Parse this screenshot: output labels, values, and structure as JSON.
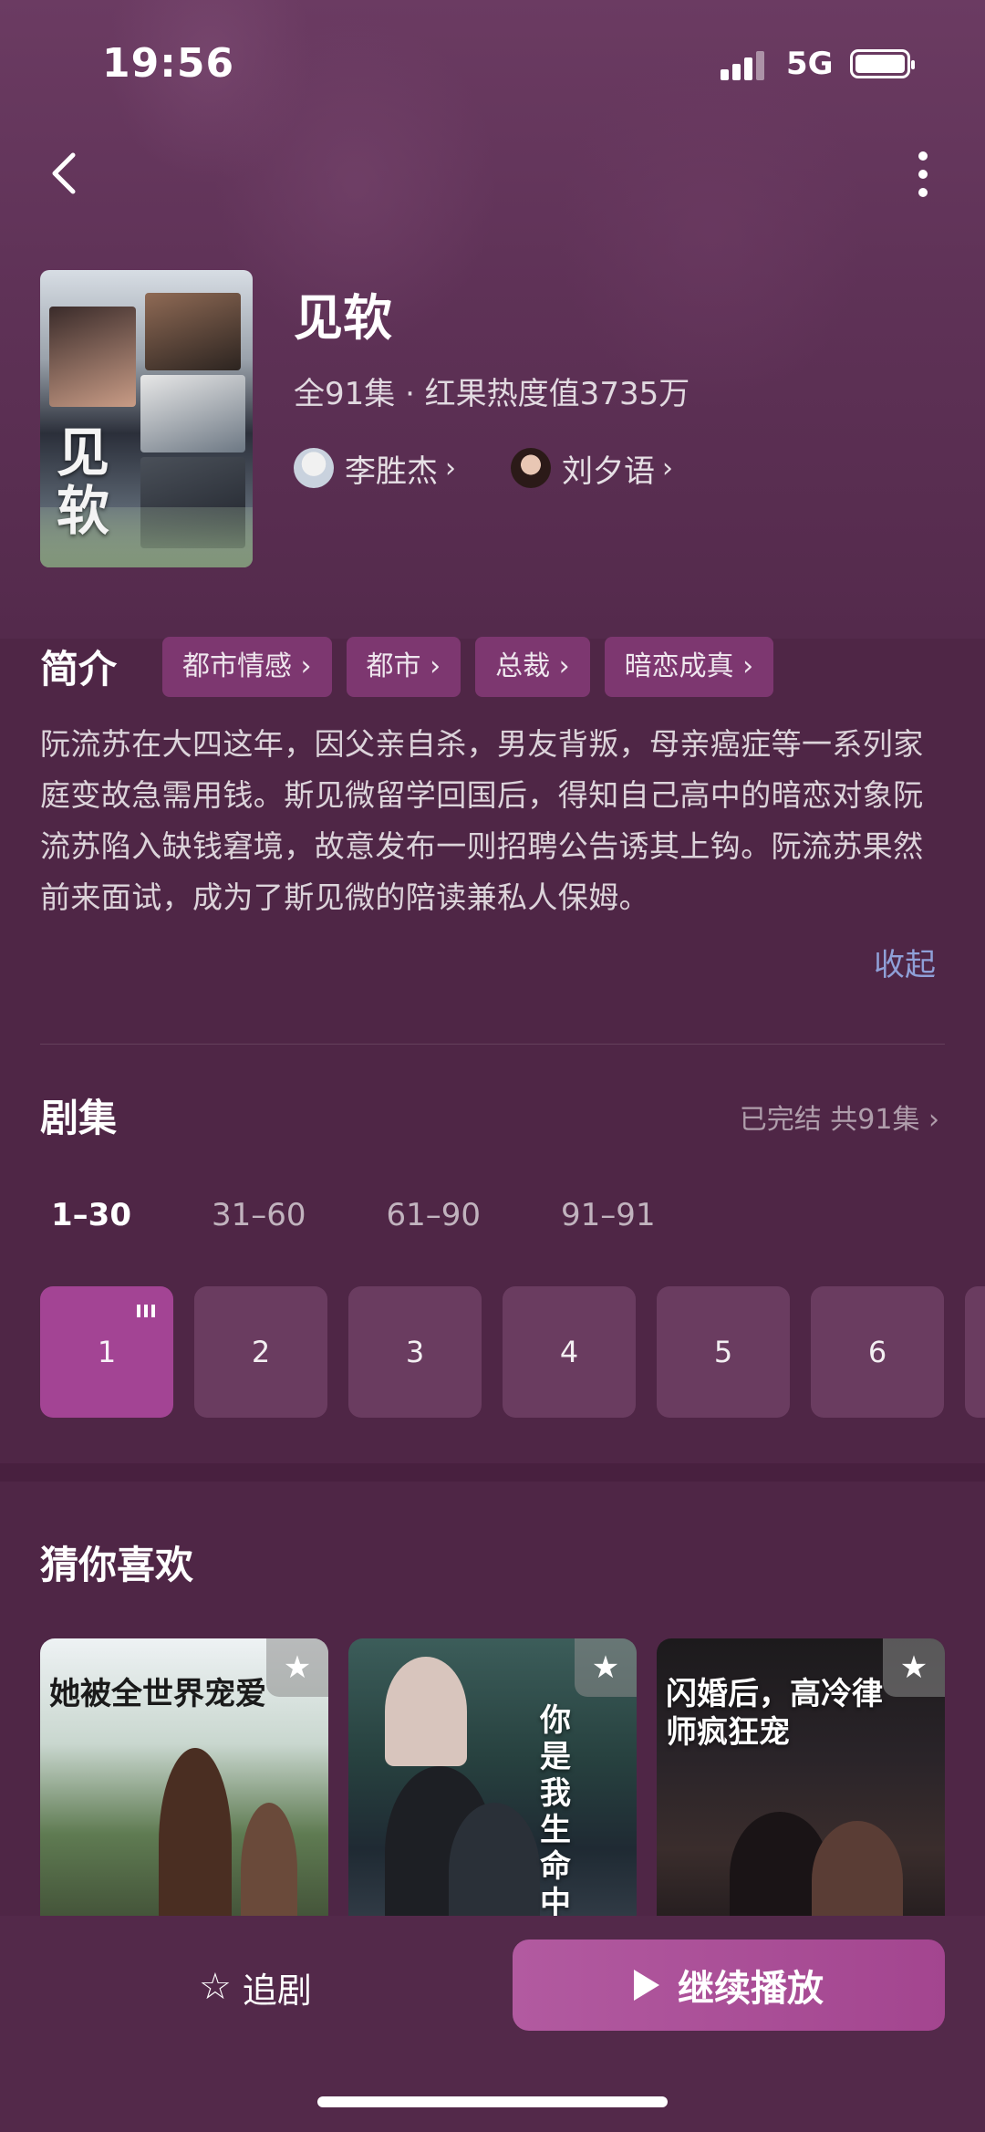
{
  "status": {
    "time": "19:56",
    "network": "5G"
  },
  "show": {
    "title": "见软",
    "poster_title": "见软",
    "meta": "全91集 · 红果热度值3735万",
    "cast": [
      {
        "name": "李胜杰"
      },
      {
        "name": "刘夕语"
      }
    ]
  },
  "intro": {
    "heading": "简介",
    "tags": [
      "都市情感",
      "都市",
      "总裁",
      "暗恋成真"
    ],
    "synopsis": "阮流苏在大四这年，因父亲自杀，男友背叛，母亲癌症等一系列家庭变故急需用钱。斯见微留学回国后，得知自己高中的暗恋对象阮流苏陷入缺钱窘境，故意发布一则招聘公告诱其上钩。阮流苏果然前来面试，成为了斯见微的陪读兼私人保姆。",
    "collapse_label": "收起"
  },
  "episodes": {
    "heading": "剧集",
    "status": "已完结 共91集",
    "ranges": [
      "1–30",
      "31–60",
      "61–90",
      "91–91"
    ],
    "active_range": 0,
    "visible": [
      "1",
      "2",
      "3",
      "4",
      "5",
      "6"
    ],
    "playing": 0
  },
  "recommend": {
    "heading": "猜你喜欢",
    "items": [
      {
        "title": "她被全世界宠爱"
      },
      {
        "title": "你是我生命中的光"
      },
      {
        "title": "闪婚后，高冷律师疯狂宠"
      }
    ]
  },
  "actions": {
    "follow_label": "追剧",
    "play_label": "继续播放"
  },
  "icons": {
    "back": "chevron-left-icon",
    "more": "more-vertical-icon",
    "star": "star-icon",
    "play": "play-icon"
  },
  "colors": {
    "accent": "#a34494",
    "tag_bg": "#7d3770",
    "link": "#8fa0d8"
  }
}
